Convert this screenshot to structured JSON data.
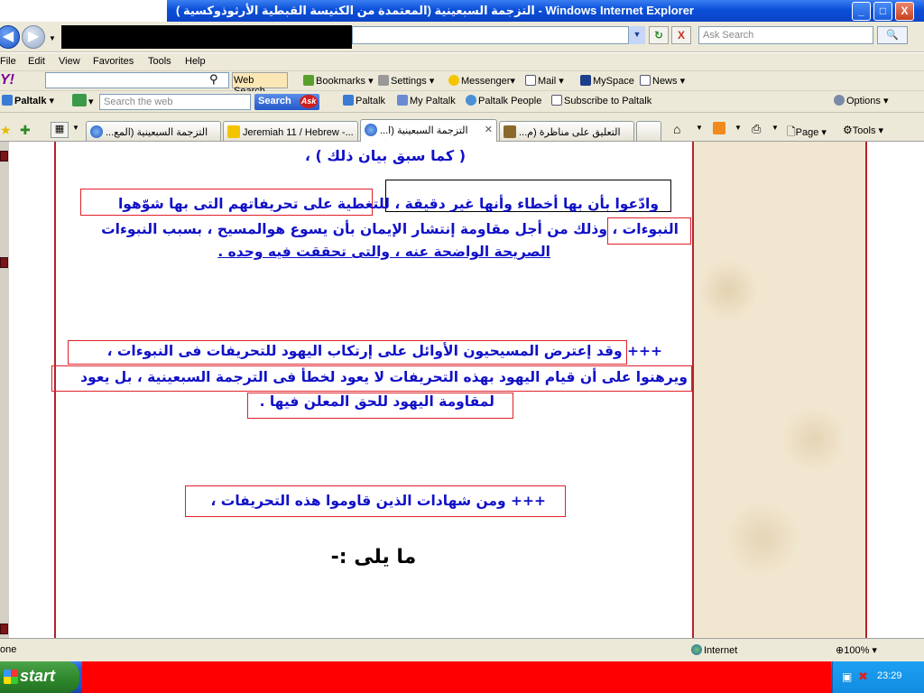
{
  "window": {
    "title": "التزجمة السبعينية (المعتمدة من الكنيسة القبطية الأرثوذوكسية ) - Windows Internet Explorer",
    "buttons": {
      "minimize": "_",
      "maximize": "□",
      "close": "X"
    }
  },
  "address_bar": {
    "back": "◀",
    "forward": "▶",
    "url": "",
    "refresh": "↻",
    "stop": "X",
    "search_placeholder": "Ask Search",
    "search_go": "🔍"
  },
  "menu": {
    "items": [
      "File",
      "Edit",
      "View",
      "Favorites",
      "Tools",
      "Help"
    ]
  },
  "yahoo_toolbar": {
    "logo": "Y!",
    "web_search_label": "Web Search",
    "items": [
      "Bookmarks",
      "Settings",
      "Messenger",
      "Mail",
      "MySpace",
      "News"
    ]
  },
  "paltalk_toolbar": {
    "logo": "Paltalk",
    "search_placeholder": "Search the web",
    "search_button": "Search",
    "search_badge": "Ask",
    "items": [
      "Paltalk",
      "My Paltalk",
      "Paltalk People",
      "Subscribe to Paltalk"
    ],
    "options": "Options"
  },
  "tabs_bar": {
    "tabs": [
      {
        "label": "...التزجمة السبعينية (المع",
        "active": false
      },
      {
        "label": "Jeremiah 11 / Hebrew -...",
        "active": false
      },
      {
        "label": "...التزجمة السبعينية (ا",
        "active": true
      },
      {
        "label": "...التعليق على مناظرة (م",
        "active": false
      }
    ],
    "commands": [
      "Page",
      "Tools"
    ]
  },
  "content": {
    "lines": {
      "line0": "( كما سبق بيان ذلك ) ،",
      "line1": "وادّعوا بأن بها أخطاء وأنها غير دقيقة ، للتغطية على تحريفاتهم التى بها شوّهوا",
      "line2": "النبوءات ، وذلك من أجل مقاومة إنتشار الإيمان بأن يسوع هوالمسيح ، بسبب النبوءات",
      "line3": "الصريحة الواضحة عنه ، والتى تحققت فيه وحده .",
      "line4": "+++ وقد إعترض المسيحيون الأوائل على إرتكاب اليهود للتحريفات فى النبوءات ،",
      "line5": "ويرهنوا على أن قيام اليهود بهذه التحريفات لا يعود لخطأ فى الترجمة السبعينية ، بل يعود",
      "line6": "لمقاومة اليهود للحق المعلن فيها .",
      "line7": "+++ ومن شهادات الذين قاوموا هذه التحريفات ،"
    },
    "heading": "ما يلى :-"
  },
  "status_bar": {
    "status": "one",
    "zone": "Internet",
    "zoom": "100%"
  },
  "taskbar": {
    "start": "start",
    "clock": "23:29"
  },
  "colors": {
    "text_blue": "#1010c8",
    "border_red": "#b5222d",
    "box_red": "#e0202a",
    "title_blue": "#0a4fd8"
  }
}
